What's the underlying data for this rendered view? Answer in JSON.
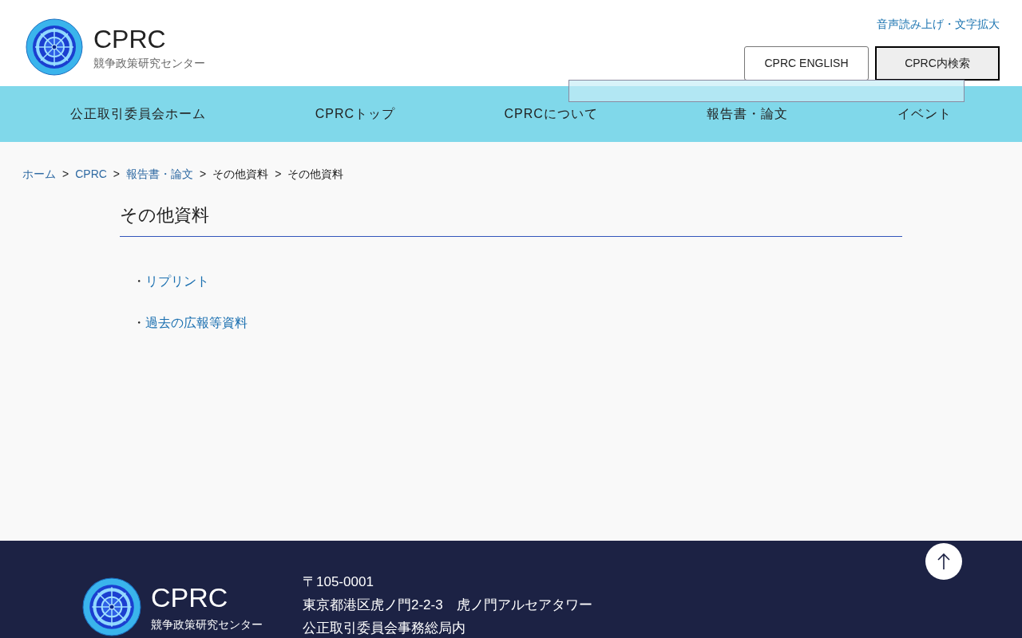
{
  "header": {
    "logo_title": "CPRC",
    "logo_subtitle": "競争政策研究センター",
    "accessibility_link": "音声読み上げ・文字拡大",
    "buttons": [
      {
        "label": "CPRC ENGLISH",
        "selected": false
      },
      {
        "label": "CPRC内検索",
        "selected": true
      }
    ]
  },
  "nav": [
    "公正取引委員会ホーム",
    "CPRCトップ",
    "CPRCについて",
    "報告書・論文",
    "イベント"
  ],
  "breadcrumb": [
    {
      "label": "ホーム",
      "link": true
    },
    {
      "label": "CPRC",
      "link": true
    },
    {
      "label": "報告書・論文",
      "link": true
    },
    {
      "label": "その他資料",
      "link": false
    },
    {
      "label": "その他資料",
      "link": false
    }
  ],
  "breadcrumb_separator": ">",
  "page_title": "その他資料",
  "bullet": "・",
  "links": [
    "リプリント",
    "過去の広報等資料"
  ],
  "footer": {
    "logo_title": "CPRC",
    "logo_subtitle": "競争政策研究センター",
    "address": [
      "〒105-0001",
      "東京都港区虎ノ門2-2-3　虎ノ門アルセアタワー",
      "公正取引委員会事務総局内"
    ]
  }
}
